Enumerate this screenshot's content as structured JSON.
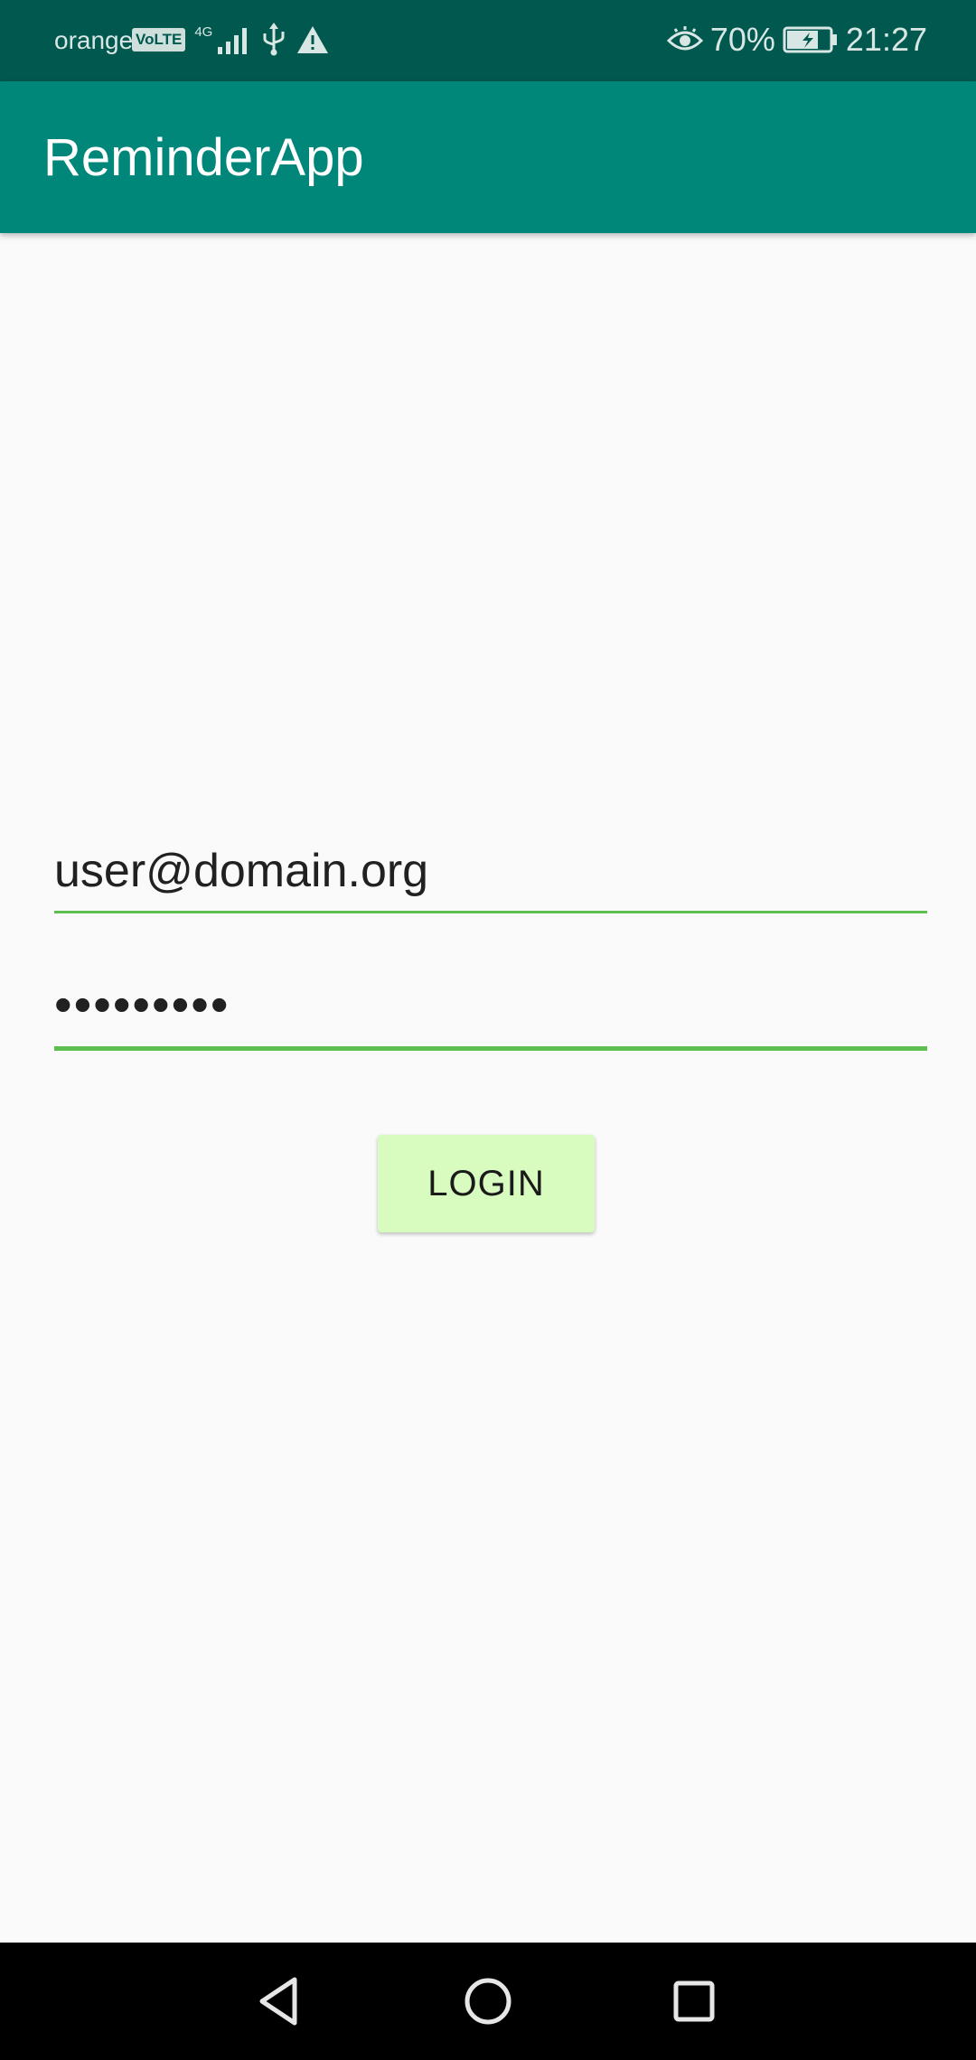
{
  "status_bar": {
    "carrier": "orange",
    "volte": "VoLTE",
    "network": "4G",
    "battery_percent": "70%",
    "time": "21:27",
    "icons": [
      "signal-bars-icon",
      "usb-icon",
      "warning-icon",
      "eye-icon",
      "battery-charging-icon"
    ]
  },
  "app_bar": {
    "title": "ReminderApp"
  },
  "login_form": {
    "email_value": "user@domain.org",
    "password_value": "•••••••••",
    "login_label": "LOGIN",
    "accent_color": "#5cbf50",
    "button_color": "#d8fbbf"
  },
  "nav_bar": {
    "icons": [
      "back-icon",
      "home-icon",
      "recent-apps-icon"
    ]
  },
  "colors": {
    "status_bar": "#00584e",
    "app_bar": "#00877a",
    "background": "#fafafa"
  }
}
